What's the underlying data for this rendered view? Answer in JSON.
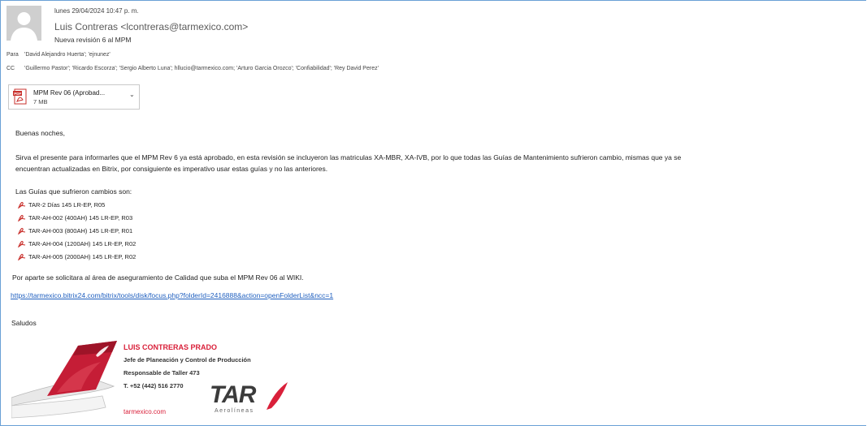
{
  "header": {
    "date": "lunes 29/04/2024 10:47 p. m.",
    "from": "Luis Contreras <lcontreras@tarmexico.com>",
    "subject": "Nueva revisión 6 al MPM"
  },
  "recipients": {
    "to_label": "Para",
    "to": "'David Alejandro Huerta'; 'ejnunez'",
    "cc_label": "CC",
    "cc": "'Guillermo Pastor'; 'Ricardo Escorza'; 'Sergio Alberto Luna'; hllucio@tarmexico.com; 'Arturo Garcia Orozco'; 'Confiabilidad'; 'Rey David Perez'"
  },
  "attachment": {
    "name": "MPM Rev 06 (Aprobad...",
    "size": "7 MB",
    "icon": "pdf-icon"
  },
  "body": {
    "greeting": "Buenas noches,",
    "para1_line1": "Sirva el presente para informarles que el MPM Rev 6 ya está aprobado, en esta revisión se incluyeron las matriculas XA-MBR, XA-IVB, por lo que todas las Guías de Mantenimiento sufrieron cambio, mismas que ya se",
    "para1_line2": "encuentran actualizadas en Bitrix, por consiguiente es imperativo usar estas guías y no las anteriores.",
    "guides_intro": "Las Guías que sufrieron cambios son:",
    "guides": [
      "TAR-2 Días 145 LR-EP, R05",
      "TAR-AH-002 (400AH) 145 LR-EP, R03",
      "TAR-AH-003 (800AH) 145 LR-EP, R01",
      "TAR-AH-004 (1200AH) 145 LR-EP, R02",
      "TAR-AH-005 (2000AH) 145 LR-EP, R02"
    ],
    "para2": "Por aparte se solicitara al área de aseguramiento de Calidad que suba el MPM Rev 06 al WIKI.",
    "link": "https://tarmexico.bitrix24.com/bitrix/tools/disk/focus.php?folderId=2416888&action=openFolderList&ncc=1",
    "closing": "Saludos"
  },
  "signature": {
    "name": "LUIS CONTRERAS PRADO",
    "role": "Jefe de Planeación y Control de Producción",
    "cert": "Responsable de Taller 473",
    "phone": "T. +52 (442) 516 2770",
    "web": "tarmexico.com",
    "logo_text": "TAR",
    "logo_sub": "Aerolíneas",
    "brand_color": "#d9203a"
  }
}
